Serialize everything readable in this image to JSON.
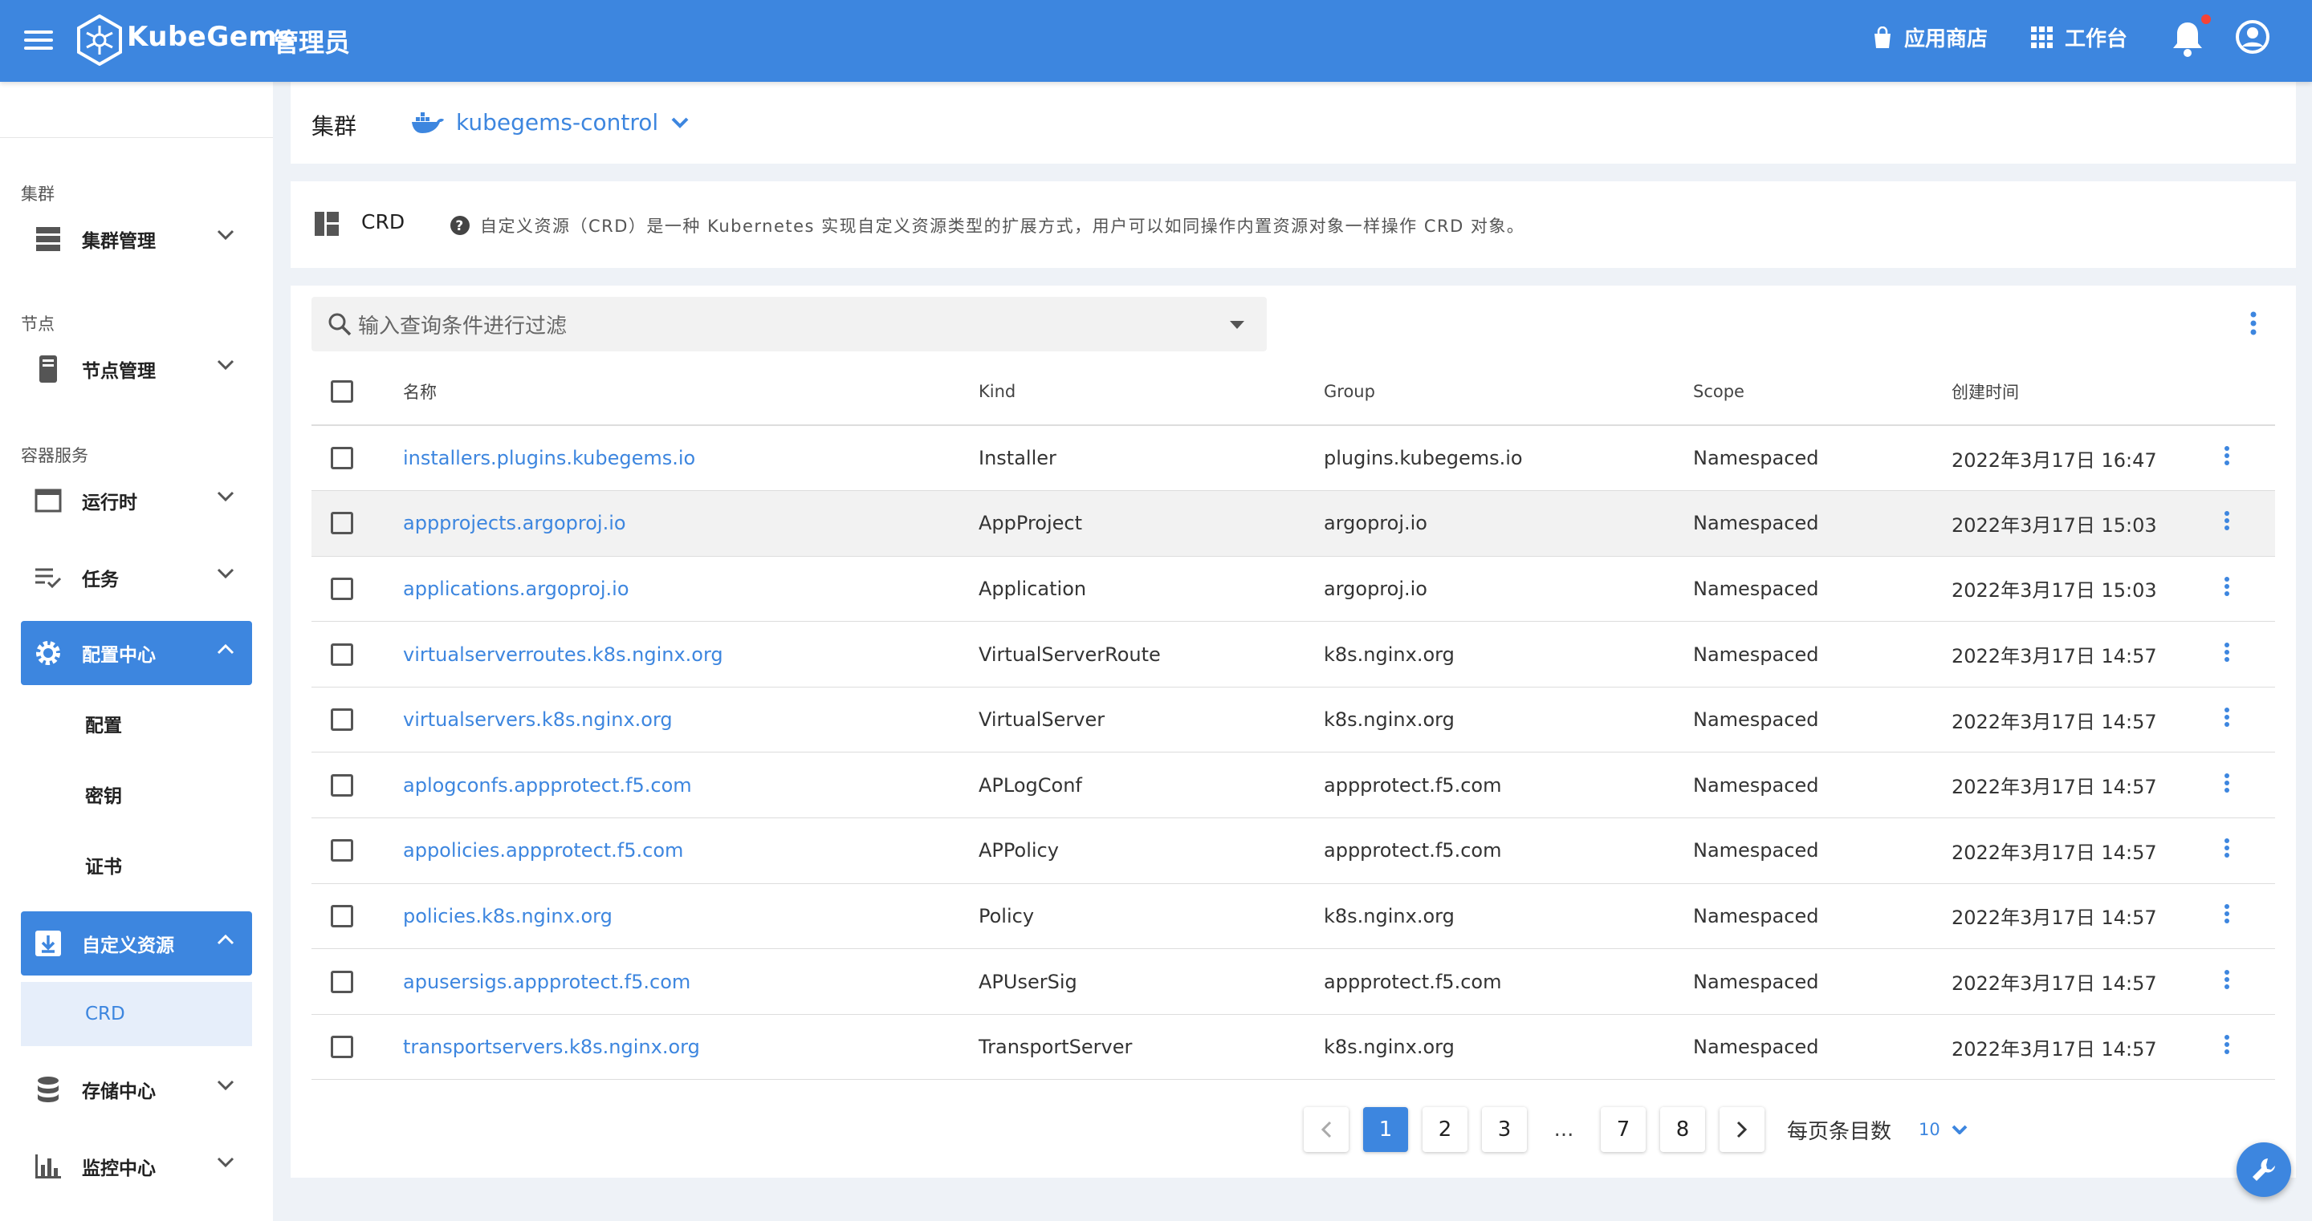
{
  "header": {
    "brand": "KubeGems",
    "role": "管理员",
    "store_label": "应用商店",
    "workbench_label": "工作台",
    "colors": {
      "primary": "#3d86df",
      "notification": "#f44336"
    }
  },
  "sidebar": {
    "sections": [
      {
        "title": "集群"
      },
      {
        "title": "节点"
      },
      {
        "title": "容器服务"
      }
    ],
    "items": [
      {
        "label": "集群管理",
        "icon": "server-icon"
      },
      {
        "label": "节点管理",
        "icon": "node-icon"
      },
      {
        "label": "运行时",
        "icon": "window-icon"
      },
      {
        "label": "任务",
        "icon": "task-list-icon"
      },
      {
        "label": "配置中心",
        "icon": "gear-icon",
        "expanded": true,
        "active": true
      },
      {
        "label": "自定义资源",
        "icon": "download-box-icon",
        "expanded": true,
        "active": true
      },
      {
        "label": "存储中心",
        "icon": "database-icon"
      },
      {
        "label": "监控中心",
        "icon": "bar-chart-icon"
      }
    ],
    "config_children": [
      "配置",
      "密钥",
      "证书"
    ],
    "crd_children": [
      "CRD"
    ]
  },
  "cluster": {
    "label": "集群",
    "name": "kubegems-control"
  },
  "crd_info": {
    "title": "CRD",
    "description": "自定义资源（CRD）是一种 Kubernetes 实现自定义资源类型的扩展方式，用户可以如同操作内置资源对象一样操作 CRD 对象。"
  },
  "search": {
    "placeholder": "输入查询条件进行过滤"
  },
  "table": {
    "columns": [
      "名称",
      "Kind",
      "Group",
      "Scope",
      "创建时间"
    ],
    "rows": [
      [
        "installers.plugins.kubegems.io",
        "Installer",
        "plugins.kubegems.io",
        "Namespaced",
        "2022年3月17日 16:47"
      ],
      [
        "appprojects.argoproj.io",
        "AppProject",
        "argoproj.io",
        "Namespaced",
        "2022年3月17日 15:03"
      ],
      [
        "applications.argoproj.io",
        "Application",
        "argoproj.io",
        "Namespaced",
        "2022年3月17日 15:03"
      ],
      [
        "virtualserverroutes.k8s.nginx.org",
        "VirtualServerRoute",
        "k8s.nginx.org",
        "Namespaced",
        "2022年3月17日 14:57"
      ],
      [
        "virtualservers.k8s.nginx.org",
        "VirtualServer",
        "k8s.nginx.org",
        "Namespaced",
        "2022年3月17日 14:57"
      ],
      [
        "aplogconfs.appprotect.f5.com",
        "APLogConf",
        "appprotect.f5.com",
        "Namespaced",
        "2022年3月17日 14:57"
      ],
      [
        "appolicies.appprotect.f5.com",
        "APPolicy",
        "appprotect.f5.com",
        "Namespaced",
        "2022年3月17日 14:57"
      ],
      [
        "policies.k8s.nginx.org",
        "Policy",
        "k8s.nginx.org",
        "Namespaced",
        "2022年3月17日 14:57"
      ],
      [
        "apusersigs.appprotect.f5.com",
        "APUserSig",
        "appprotect.f5.com",
        "Namespaced",
        "2022年3月17日 14:57"
      ],
      [
        "transportservers.k8s.nginx.org",
        "TransportServer",
        "k8s.nginx.org",
        "Namespaced",
        "2022年3月17日 14:57"
      ]
    ],
    "highlighted_row": 1
  },
  "pagination": {
    "pages": [
      "1",
      "2",
      "3",
      "...",
      "7",
      "8"
    ],
    "current": "1",
    "per_page_label": "每页条目数",
    "per_page_value": "10"
  }
}
